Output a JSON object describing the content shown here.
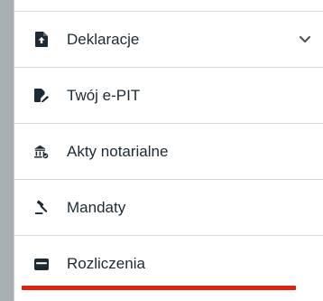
{
  "menu": {
    "items": [
      {
        "label": "Deklaracje",
        "icon": "file-upload-icon",
        "expandable": true
      },
      {
        "label": "Twój e-PIT",
        "icon": "file-signature-icon",
        "expandable": false
      },
      {
        "label": "Akty notarialne",
        "icon": "bank-building-icon",
        "expandable": false
      },
      {
        "label": "Mandaty",
        "icon": "gavel-icon",
        "expandable": false
      },
      {
        "label": "Rozliczenia",
        "icon": "wallet-icon",
        "expandable": false,
        "active": true
      }
    ]
  },
  "colors": {
    "text": "#1d2a33",
    "active_indicator": "#e2230c",
    "background": "#a9b0b4"
  }
}
